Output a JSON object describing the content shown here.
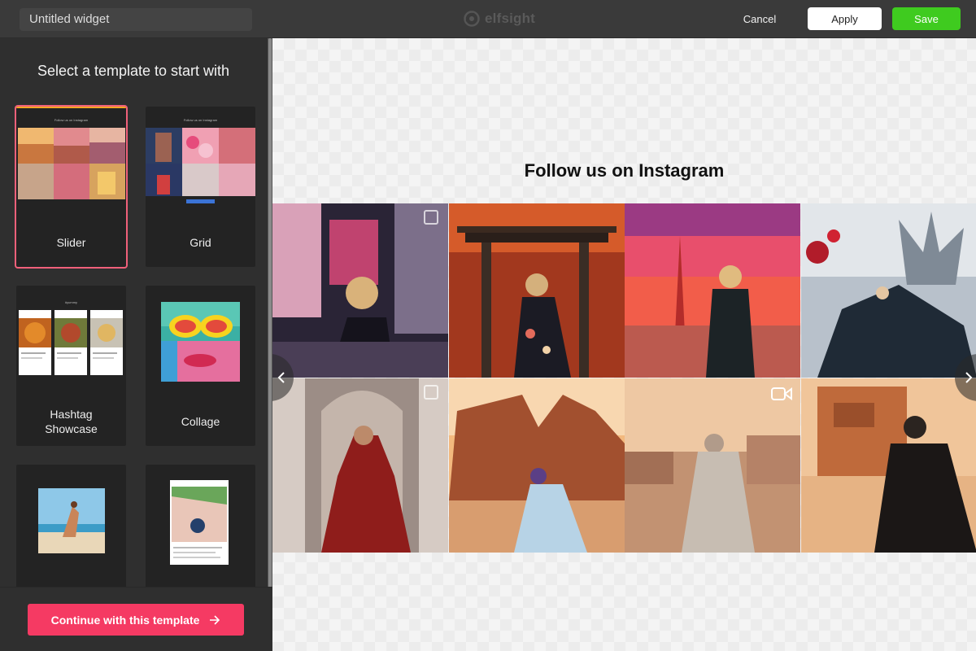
{
  "header": {
    "widget_name": "Untitled widget",
    "brand": "elfsight",
    "cancel": "Cancel",
    "apply": "Apply",
    "save": "Save",
    "save_color": "#3fcb1f"
  },
  "sidebar": {
    "title": "Select a template to start with",
    "templates": [
      {
        "label": "Slider",
        "selected": true,
        "mini_title": "Follow us on Instagram"
      },
      {
        "label": "Grid",
        "selected": false,
        "mini_title": "Follow us on Instagram"
      },
      {
        "label_line1": "Hashtag",
        "label_line2": "Showcase",
        "selected": false,
        "mini_title": "#yummy"
      },
      {
        "label": "Collage",
        "selected": false
      },
      {
        "label": "",
        "selected": false
      },
      {
        "label": "",
        "selected": false
      }
    ],
    "continue_button": "Continue with this template",
    "accent_color": "#f53a63"
  },
  "preview": {
    "title": "Follow us on Instagram",
    "prev_icon": "chevron-left-icon",
    "next_icon": "chevron-right-icon",
    "tiles": [
      {
        "name": "neon-street"
      },
      {
        "name": "torii-gate"
      },
      {
        "name": "tokyo-tower"
      },
      {
        "name": "castle"
      },
      {
        "name": "ornate-door"
      },
      {
        "name": "desert-rock-arch"
      },
      {
        "name": "desert-cliffs"
      },
      {
        "name": "tomb-facade"
      }
    ]
  }
}
